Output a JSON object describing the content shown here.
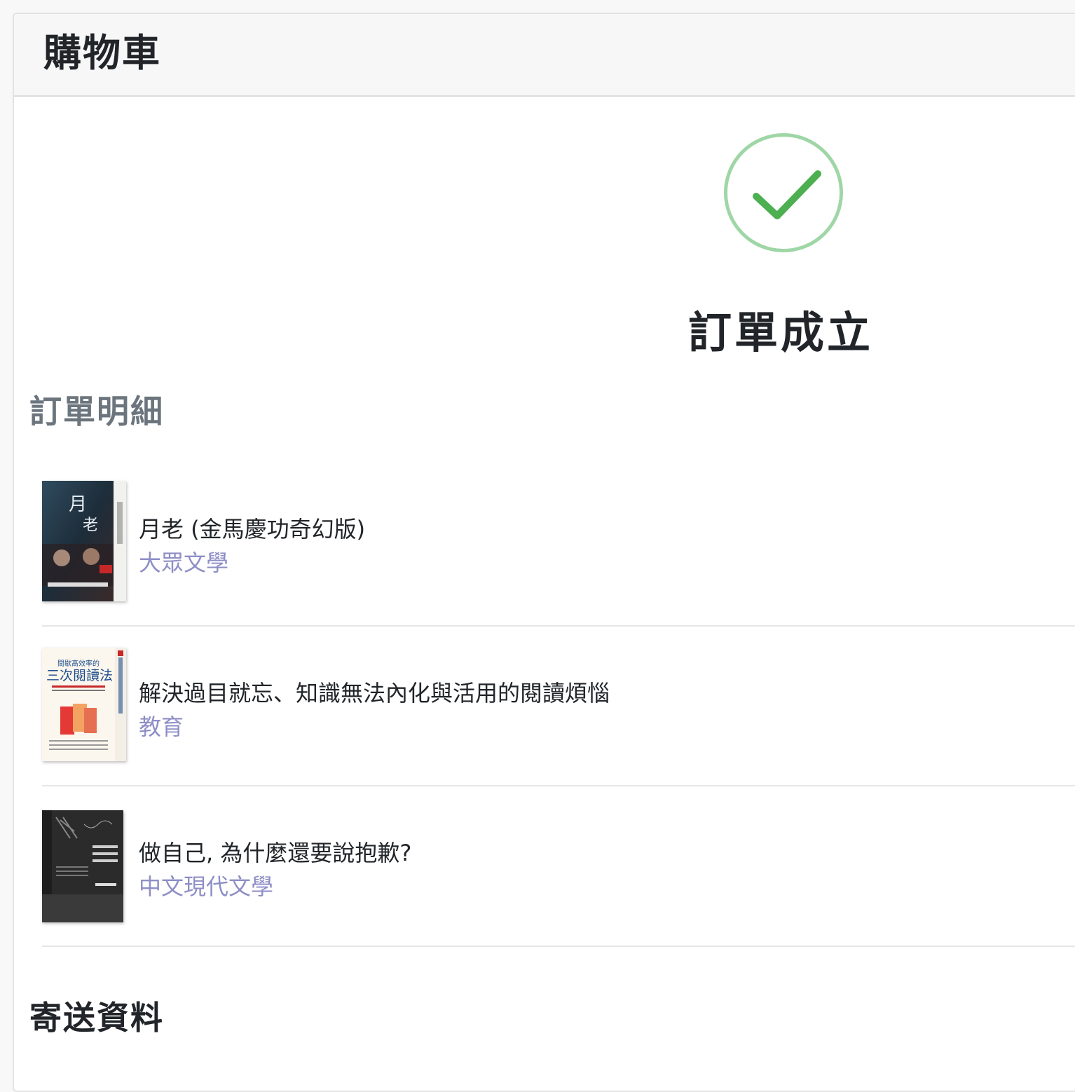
{
  "header": {
    "title": "購物車"
  },
  "success": {
    "icon": "check-circle-icon",
    "title": "訂單成立",
    "color": "#4caf50"
  },
  "order_details": {
    "title": "訂單明細",
    "items": [
      {
        "name": "月老 (金馬慶功奇幻版)",
        "category": "大眾文學"
      },
      {
        "name": "解決過目就忘、知識無法內化與活用的閱讀煩惱",
        "category": "教育"
      },
      {
        "name": "做自己, 為什麼還要說抱歉?",
        "category": "中文現代文學"
      }
    ]
  },
  "shipping": {
    "title": "寄送資料"
  },
  "colors": {
    "category_link": "#8e8ec7",
    "success_ring": "#9fd6a6",
    "muted_heading": "#6c757d"
  }
}
